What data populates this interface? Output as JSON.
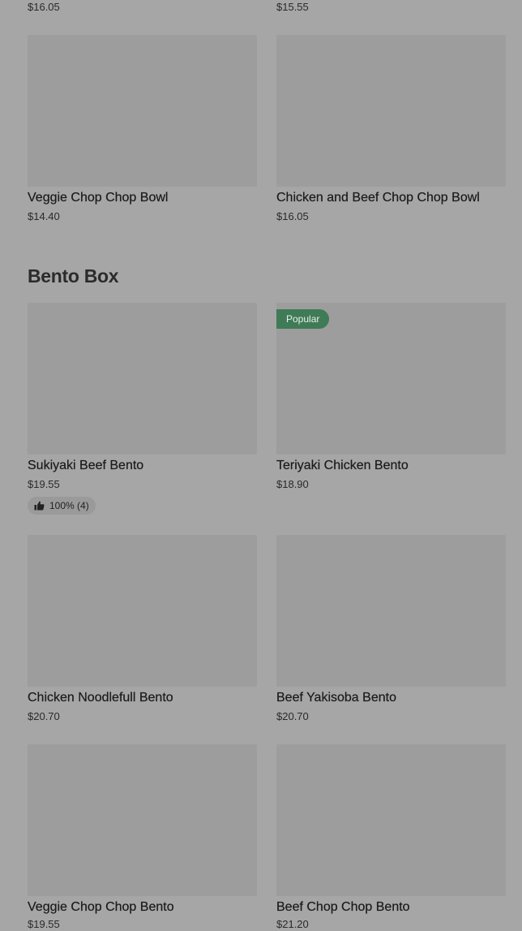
{
  "top_row": {
    "left_price": "$16.05",
    "right_price": "$15.55"
  },
  "row1": [
    {
      "name": "Veggie Chop Chop Bowl",
      "price": "$14.40"
    },
    {
      "name": "Chicken and Beef Chop Chop Bowl",
      "price": "$16.05"
    }
  ],
  "bento_section": {
    "title": "Bento Box",
    "items": [
      {
        "name": "Sukiyaki Beef Bento",
        "price": "$19.55",
        "rating": "100% (4)"
      },
      {
        "name": "Teriyaki Chicken Bento",
        "price": "$18.90",
        "badge": "Popular"
      },
      {
        "name": "Chicken Noodlefull Bento",
        "price": "$20.70"
      },
      {
        "name": "Beef Yakisoba Bento",
        "price": "$20.70"
      },
      {
        "name": "Veggie Chop Chop Bento",
        "price": "$19.55"
      },
      {
        "name": "Beef Chop Chop Bento",
        "price": "$21.20"
      }
    ]
  },
  "icons": {
    "rating": "thumbs-up-icon"
  }
}
